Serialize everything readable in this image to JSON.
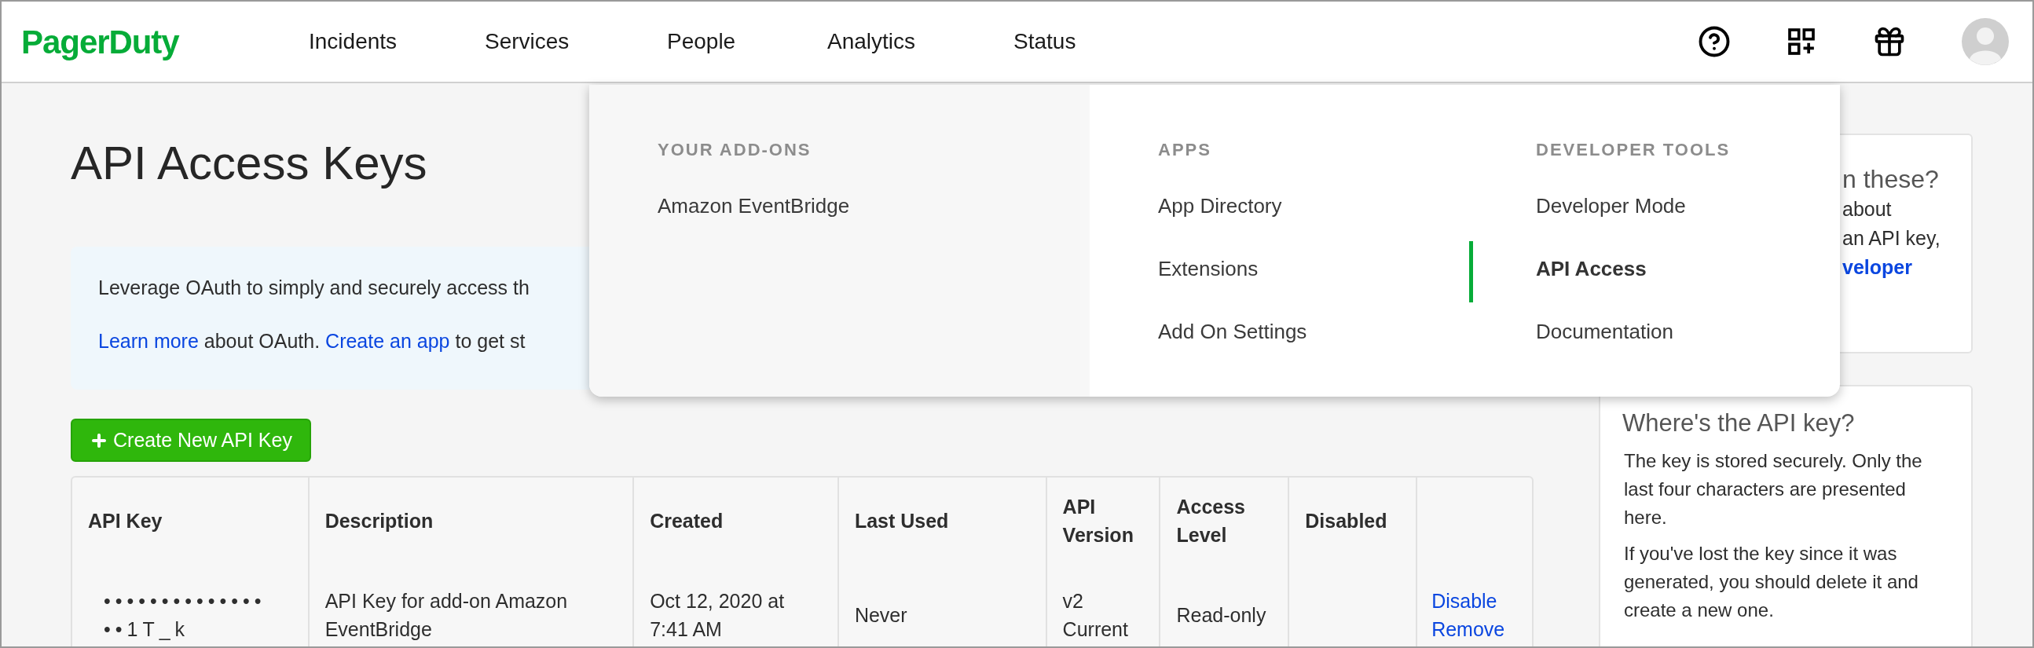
{
  "brand": "PagerDuty",
  "nav": [
    {
      "label": "Incidents"
    },
    {
      "label": "Services"
    },
    {
      "label": "People"
    },
    {
      "label": "Analytics"
    },
    {
      "label": "Status"
    }
  ],
  "page": {
    "title": "API Access Keys",
    "info": [
      [
        {
          "kind": "text",
          "text": "Leverage OAuth to simply and securely access th"
        }
      ],
      [
        {
          "kind": "link",
          "text": "Learn more"
        },
        {
          "kind": "text",
          "text": " about OAuth. "
        },
        {
          "kind": "link",
          "text": "Create an app"
        },
        {
          "kind": "text",
          "text": " to get st"
        }
      ]
    ],
    "create_button": "Create New API Key"
  },
  "table": {
    "columns": [
      "API Key",
      "Description",
      "Created",
      "Last Used",
      "API Version",
      "Access Level",
      "Disabled",
      ""
    ],
    "rows": [
      {
        "cells": [
          "••••••••••••••••1T_k",
          "API Key for add-on Amazon EventBridge",
          "Oct 12, 2020 at 7:41 AM",
          "Never",
          "v2 Current",
          "Read-only",
          ""
        ],
        "actions": [
          "Disable",
          "Remove"
        ]
      }
    ]
  },
  "sidebar": {
    "cards": [
      {
        "title": "n these?",
        "lines": [
          {
            "kind": "text",
            "text": "about"
          },
          {
            "kind": "text",
            "text": "an API key,"
          },
          {
            "kind": "link",
            "text": "veloper"
          }
        ]
      },
      {
        "title": "Where's the API key?",
        "paragraphs": [
          "The key is stored securely. Only the last four characters are presented here.",
          "If you've lost the key since it was generated, you should delete it and create a new one."
        ]
      }
    ]
  },
  "menu": {
    "sections": [
      {
        "heading": "YOUR ADD-ONS",
        "items": [
          {
            "label": "Amazon EventBridge",
            "selected": false
          }
        ]
      },
      {
        "heading": "APPS",
        "items": [
          {
            "label": "App Directory",
            "selected": false
          },
          {
            "label": "Extensions",
            "selected": false
          },
          {
            "label": "Add On Settings",
            "selected": false
          }
        ]
      },
      {
        "heading": "DEVELOPER TOOLS",
        "items": [
          {
            "label": "Developer Mode",
            "selected": false
          },
          {
            "label": "API Access",
            "selected": true
          },
          {
            "label": "Documentation",
            "selected": false
          }
        ]
      }
    ]
  }
}
